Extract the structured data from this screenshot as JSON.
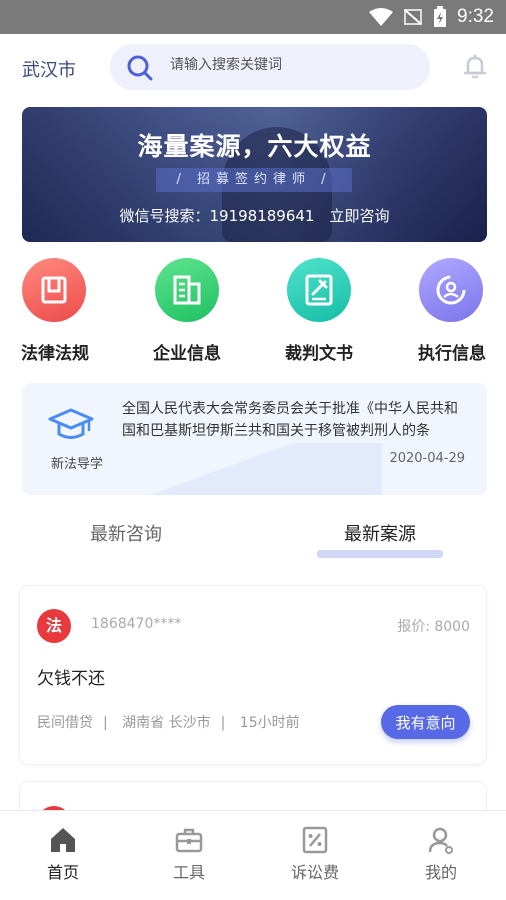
{
  "status_bar": {
    "time": "9:32"
  },
  "header": {
    "city": "武汉市",
    "search_placeholder": "请输入搜索关键词"
  },
  "banner": {
    "title": "海量案源，六大权益",
    "subtitle": "/ 招募签约律师 /",
    "contact_line": "微信号搜索：19198189641　立即咨询"
  },
  "categories": [
    {
      "label": "法律法规",
      "icon": "law-book-icon",
      "color": "#ef5a5a"
    },
    {
      "label": "企业信息",
      "icon": "building-icon",
      "color": "#2fcf6f"
    },
    {
      "label": "裁判文书",
      "icon": "judgment-doc-icon",
      "color": "#22c9b4"
    },
    {
      "label": "执行信息",
      "icon": "execution-icon",
      "color": "#8b86f2"
    }
  ],
  "notice": {
    "caption": "新法导学",
    "text": "全国人民代表大会常务委员会关于批准《中华人民共和国和巴基斯坦伊斯兰共和国关于移管被判刑人的条",
    "date": "2020-04-29"
  },
  "tabs": [
    {
      "label": "最新咨询",
      "active": false
    },
    {
      "label": "最新案源",
      "active": true
    }
  ],
  "case_card": {
    "avatar_text": "法",
    "phone": "1868470****",
    "price": "报价: 8000",
    "title": "欠钱不还",
    "category": "民间借贷",
    "location": "湖南省 长沙市",
    "time": "15小时前",
    "sep": "|",
    "button": "我有意向"
  },
  "bottom_nav": [
    {
      "label": "首页",
      "icon": "home-icon",
      "active": true
    },
    {
      "label": "工具",
      "icon": "toolbox-icon",
      "active": false
    },
    {
      "label": "诉讼费",
      "icon": "fee-icon",
      "active": false
    },
    {
      "label": "我的",
      "icon": "profile-icon",
      "active": false
    }
  ],
  "colors": {
    "accent": "#5869e6",
    "tab_indicator": "#cfd8f7",
    "banner_bg": "#2c3970"
  }
}
